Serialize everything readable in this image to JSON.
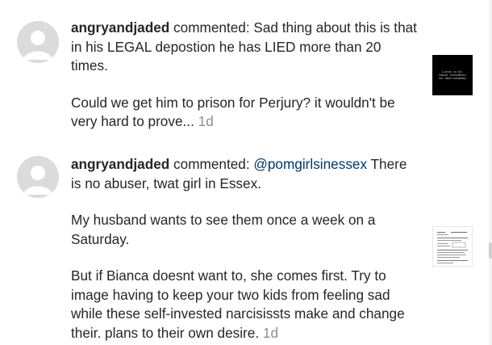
{
  "notifications": [
    {
      "username": "angryandjaded",
      "action": " commented: ",
      "lines": [
        "Sad thing about this is that in his LEGAL depostion he has LIED more than 20 times."
      ],
      "last_line": "Could we get him to prison for Perjury? it wouldn't be very hard to prove...",
      "time": "1d",
      "thumbnail_text": [
        "Listen to all",
        "Sawyer Statements",
        "her @mollsandbaby"
      ]
    },
    {
      "username": "angryandjaded",
      "action": " commented: ",
      "mention": "@pomgirlsinessex",
      "first_rest": " There is no abuser, twat girl in Essex.",
      "lines": [
        "My husband wants to see them once a week on a Saturday."
      ],
      "last_line": "But if Bianca doesnt want to, she comes first. Try to image having to keep your two kids from feeling sad while these self-invested narcisissts make and change their. plans to their own desire.",
      "time": "1d"
    }
  ]
}
